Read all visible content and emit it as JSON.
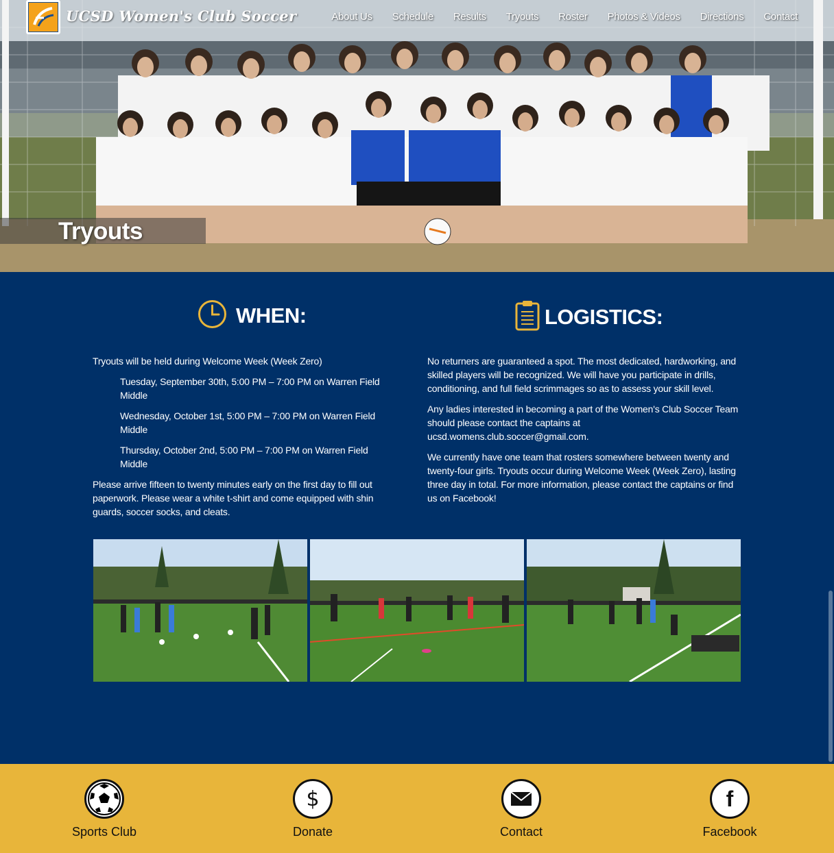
{
  "site": {
    "title": "UCSD Women's Club Soccer",
    "brand_colors": {
      "navy": "#003068",
      "gold": "#e8b53a",
      "accent": "#f4a21b"
    }
  },
  "nav": {
    "items": [
      {
        "label": "About Us"
      },
      {
        "label": "Schedule"
      },
      {
        "label": "Results"
      },
      {
        "label": "Tryouts"
      },
      {
        "label": "Roster"
      },
      {
        "label": "Photos & Videos"
      },
      {
        "label": "Directions"
      },
      {
        "label": "Contact"
      }
    ]
  },
  "hero": {
    "page_title": "Tryouts",
    "image_alt": "team-photo"
  },
  "when": {
    "heading": "WHEN:",
    "icon": "clock-icon",
    "intro": "Tryouts will be held during Welcome Week (Week Zero)",
    "dates": [
      "Tuesday, September 30th, 5:00 PM – 7:00 PM on Warren Field Middle",
      "Wednesday, October 1st, 5:00 PM – 7:00 PM on Warren Field Middle",
      "Thursday, October 2nd, 5:00 PM – 7:00 PM on Warren Field Middle"
    ],
    "note": "Please arrive fifteen to twenty minutes early on the first day to fill out paperwork. Please wear a white t-shirt and come equipped with shin guards, soccer socks, and cleats."
  },
  "logistics": {
    "heading": "LOGISTICS:",
    "icon": "clipboard-icon",
    "paragraphs": [
      "No returners are guaranteed a spot. The most dedicated, hardworking, and skilled players will be recognized. We will have you participate in drills, conditioning, and full field scrimmages so as to assess your skill level.",
      "Any ladies interested in becoming a part of the Women's Club Soccer Team should please contact the captains at ucsd.womens.club.soccer@gmail.com.",
      "We currently have one team that rosters somewhere between twenty and twenty-four girls. Tryouts occur during Welcome Week (Week Zero), lasting three day in total. For more information, please contact the captains or find us on Facebook!"
    ]
  },
  "footer": {
    "items": [
      {
        "label": "Sports Club",
        "icon": "soccer-ball-icon"
      },
      {
        "label": "Donate",
        "icon": "dollar-icon"
      },
      {
        "label": "Contact",
        "icon": "envelope-icon"
      },
      {
        "label": "Facebook",
        "icon": "facebook-icon"
      }
    ]
  }
}
